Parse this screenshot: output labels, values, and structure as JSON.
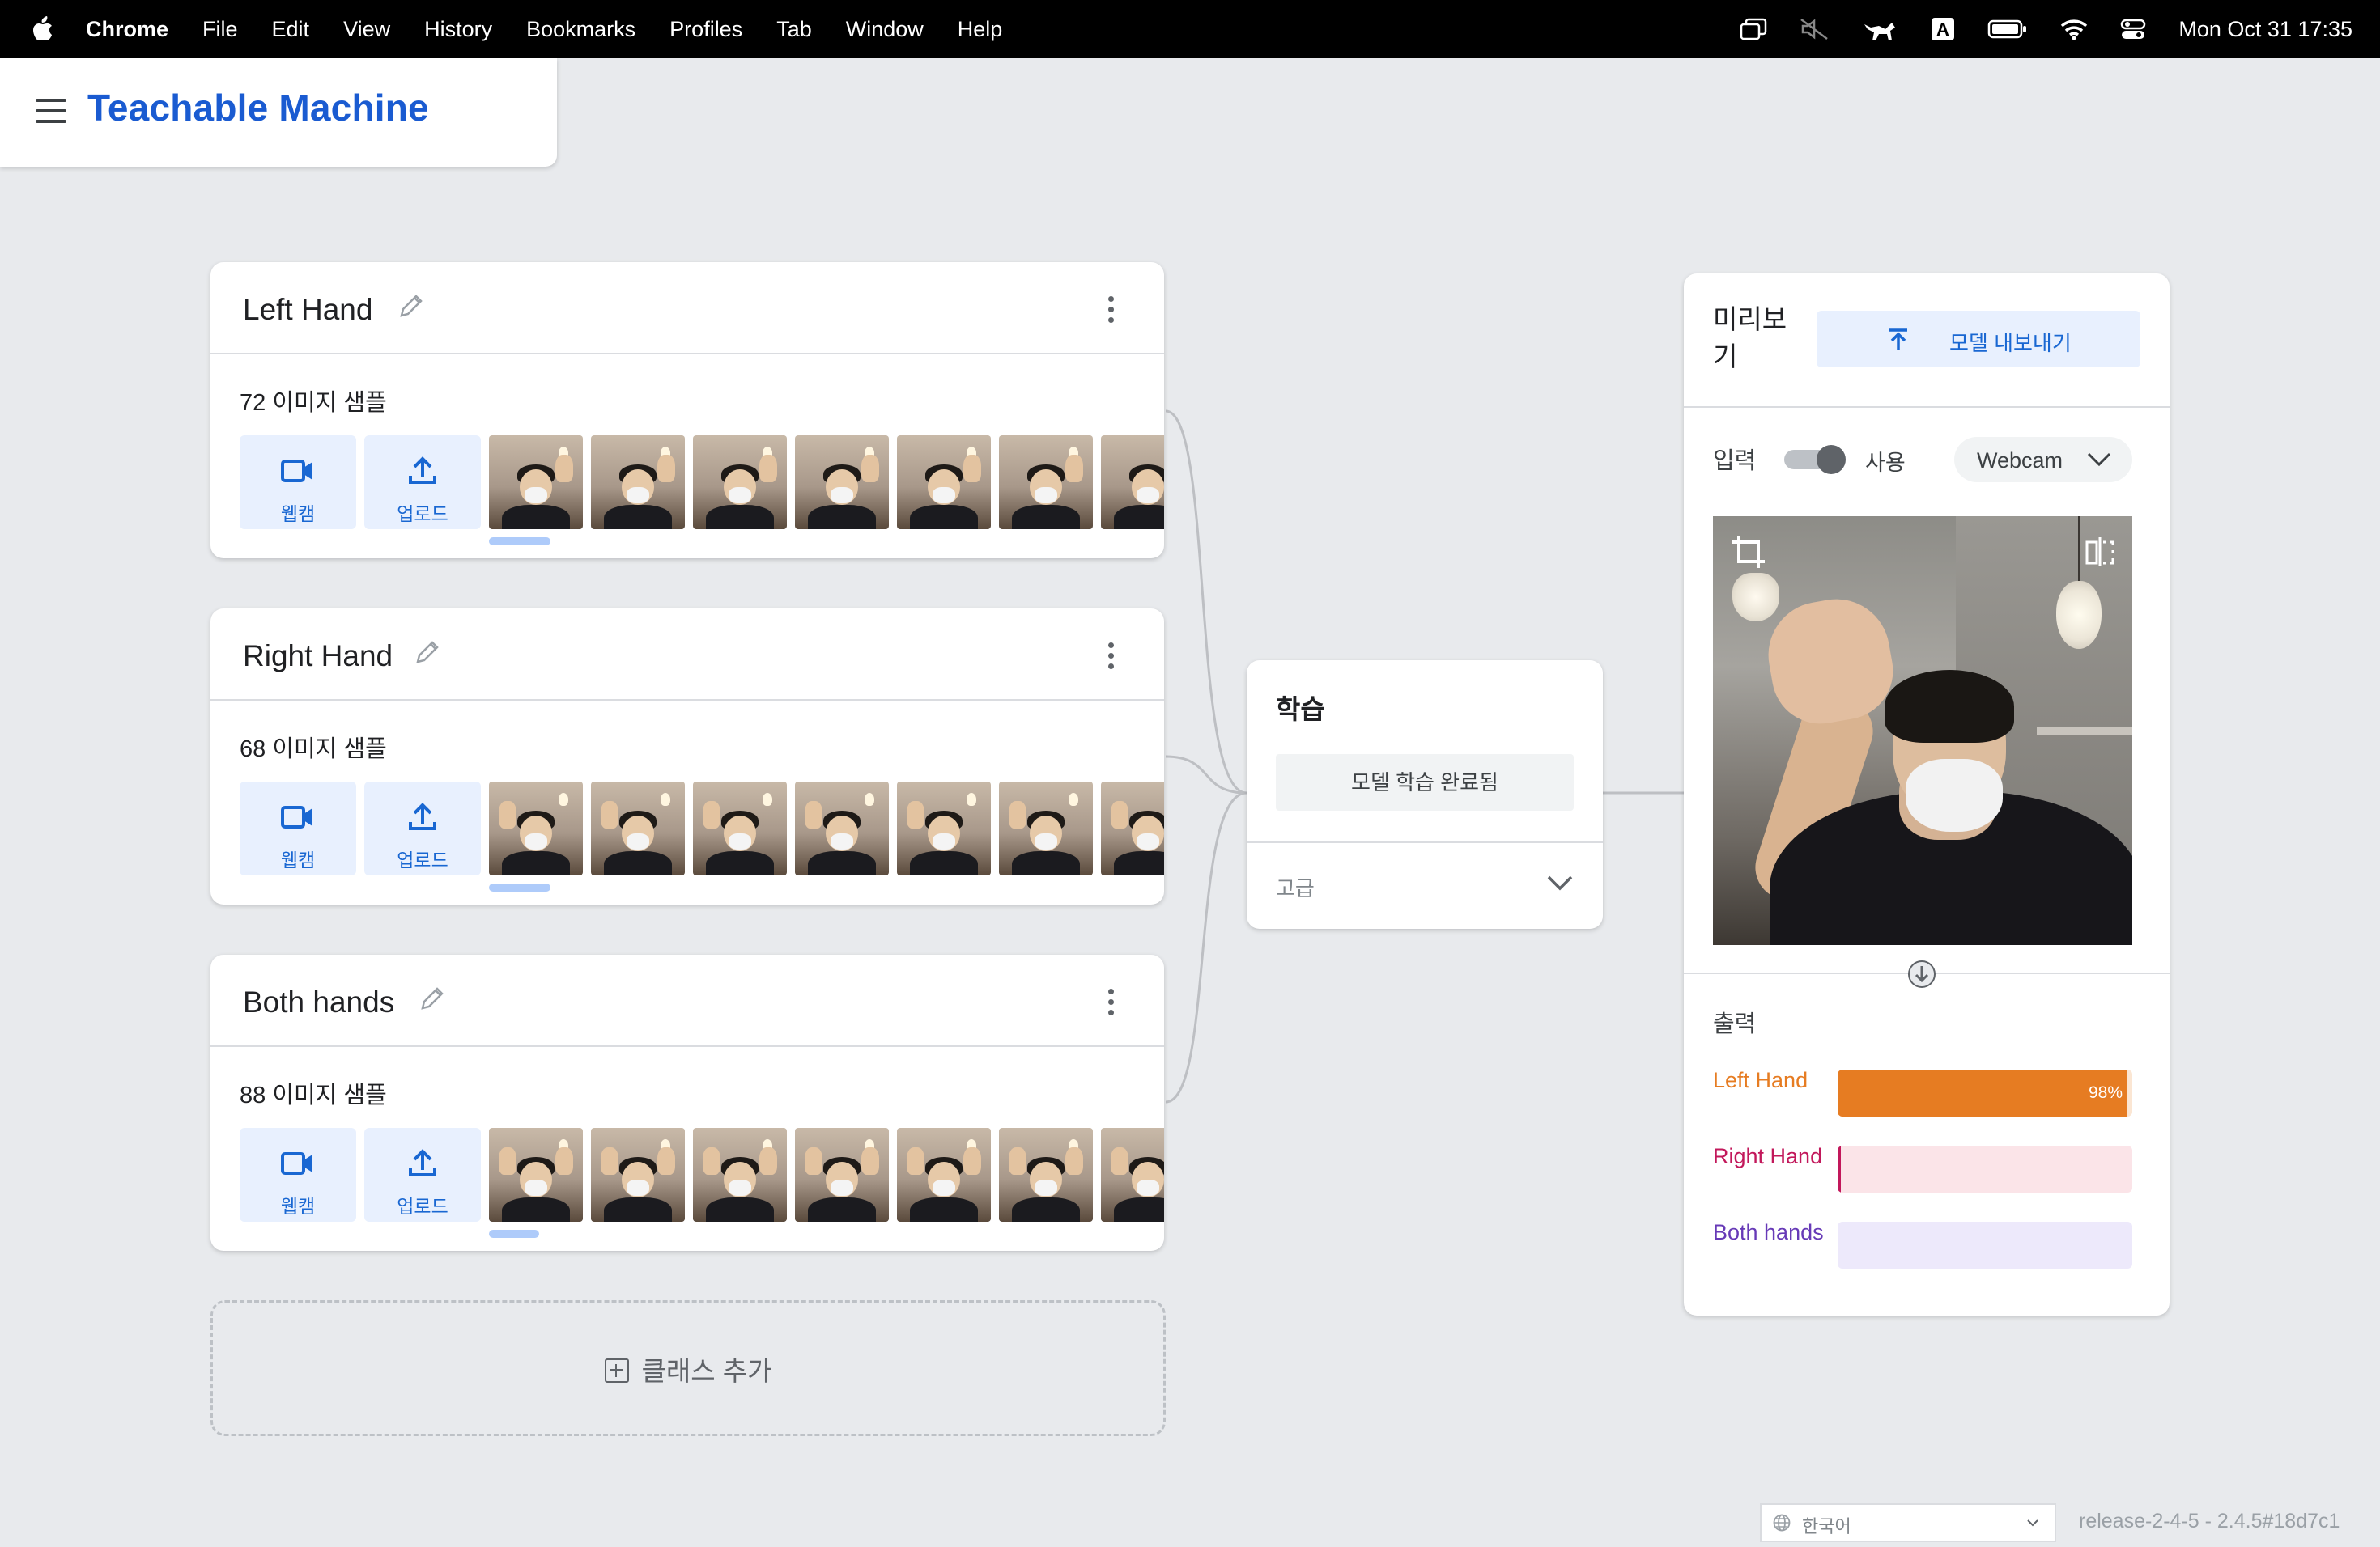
{
  "menubar": {
    "app": "Chrome",
    "items": [
      "File",
      "Edit",
      "View",
      "History",
      "Bookmarks",
      "Profiles",
      "Tab",
      "Window",
      "Help"
    ],
    "clock": "Mon Oct 31  17:35",
    "status_icons": [
      "screen-mirror-icon",
      "mute-icon",
      "cat-app-icon",
      "input-source-A-icon",
      "battery-icon",
      "wifi-icon",
      "control-center-icon"
    ],
    "input_letter": "A"
  },
  "header": {
    "title": "Teachable Machine"
  },
  "classes": [
    {
      "name": "Left Hand",
      "count": "72 이미지 샘플",
      "webcam": "웹캠",
      "upload": "업로드"
    },
    {
      "name": "Right Hand",
      "count": "68 이미지 샘플",
      "webcam": "웹캠",
      "upload": "업로드"
    },
    {
      "name": "Both hands",
      "count": "88 이미지 샘플",
      "webcam": "웹캠",
      "upload": "업로드"
    }
  ],
  "add_class": "클래스 추가",
  "training": {
    "title": "학습",
    "button": "모델 학습 완료됨",
    "advanced": "고급"
  },
  "preview": {
    "title": "미리보기",
    "export": "모델 내보내기",
    "input_label": "입력",
    "toggle_label": "사용",
    "input_source": "Webcam",
    "output_label": "출력",
    "outputs": [
      {
        "label": "Left Hand",
        "value": 0.98,
        "pct": "98%",
        "color": "#e67c22",
        "bg": "#fbe6d3"
      },
      {
        "label": "Right Hand",
        "value": 0.01,
        "pct": "",
        "color": "#c2185b",
        "bg": "#fbe4e8"
      },
      {
        "label": "Both hands",
        "value": 0.0,
        "pct": "",
        "color": "#673ab7",
        "bg": "#ede9fb"
      }
    ]
  },
  "footer": {
    "language": "한국어",
    "release": "release-2-4-5 - 2.4.5#18d7c1"
  }
}
